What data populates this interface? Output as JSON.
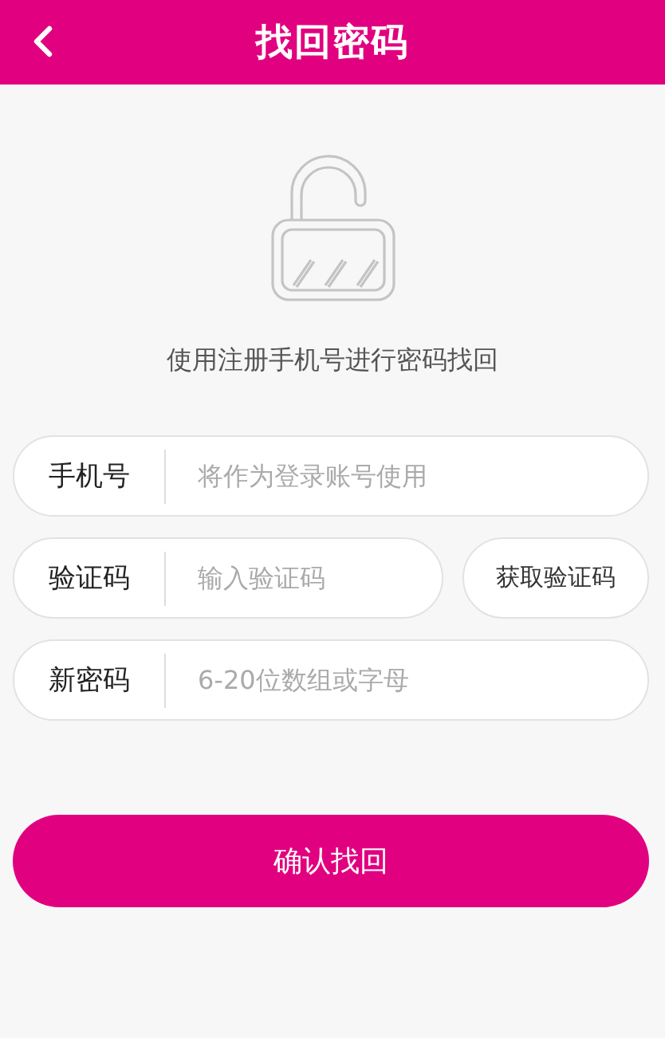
{
  "header": {
    "title": "找回密码"
  },
  "hint": "使用注册手机号进行密码找回",
  "fields": [
    {
      "kind": "plain",
      "label": "手机号",
      "placeholder": "将作为登录账号使用"
    },
    {
      "kind": "code",
      "label": "验证码",
      "placeholder": "输入验证码",
      "button": "获取验证码"
    },
    {
      "kind": "plain",
      "label": "新密码",
      "placeholder": "6-20位数组或字母"
    }
  ],
  "submit": "确认找回"
}
